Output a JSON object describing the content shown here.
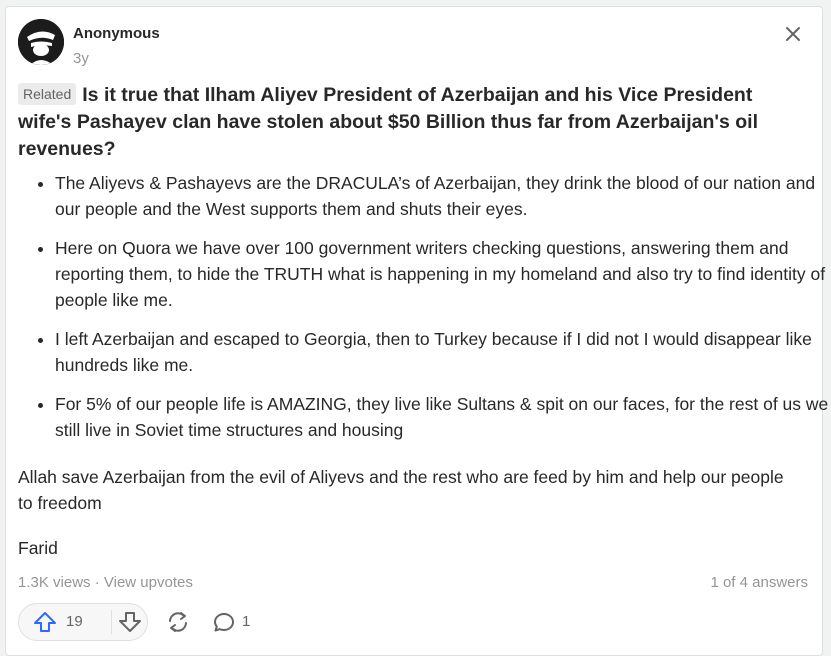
{
  "author": {
    "name": "Anonymous",
    "timestamp": "3y"
  },
  "question": {
    "badge": "Related",
    "text": "Is it true that Ilham Aliyev President of Azerbaijan and his Vice President wife's Pashayev clan have stolen about $50 Billion thus far from Azerbaijan's oil revenues?"
  },
  "answer": {
    "bullets": [
      "The Aliyevs & Pashayevs are the DRACULA’s of Azerbaijan, they drink the blood of our nation and our people and the West supports them and shuts their eyes.",
      "Here on Quora we have over 100 government writers checking questions, answering them and reporting them, to hide the TRUTH what is happening in my homeland and also try to find identity of people like me.",
      "I left Azerbaijan and escaped to Georgia, then to Turkey because if I did not I would disappear like hundreds like me.",
      "For 5% of our people life is AMAZING, they live like Sultans & spit on our faces, for the rest of us we still live in Soviet time structures and housing"
    ],
    "paragraph": "Allah save Azerbaijan from the evil of Aliyevs and the rest who are feed by him and help our people to freedom",
    "signature": "Farid"
  },
  "meta": {
    "views": "1.3K views",
    "separator": " · ",
    "upvotes_link": "View upvotes",
    "answer_position": "1 of 4 answers"
  },
  "actions": {
    "upvotes": "19",
    "comments": "1"
  },
  "colors": {
    "accent_blue": "#2e69ff",
    "text": "#282829",
    "muted": "#939598"
  },
  "icons": [
    "close-icon",
    "upvote-arrow-icon",
    "downvote-arrow-icon",
    "share-icon",
    "comment-icon"
  ]
}
